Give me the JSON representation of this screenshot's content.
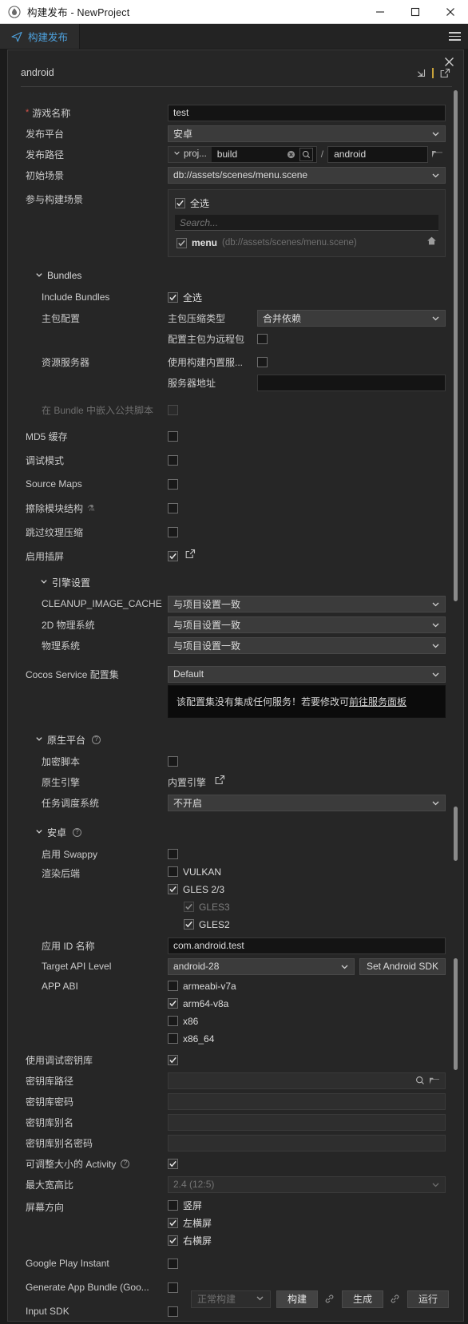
{
  "window": {
    "title": "构建发布 - NewProject",
    "minimize": "—",
    "maximize": "□",
    "close": "✕"
  },
  "tabstrip": {
    "tab_label": "构建发布",
    "menu_icon": "hamburger-icon"
  },
  "panel": {
    "title": "android",
    "close_label": "✕",
    "import_icon": "import-icon",
    "export_icon": "export-icon"
  },
  "fields": {
    "game_name": {
      "label": "游戏名称",
      "value": "test",
      "required": "*"
    },
    "platform": {
      "label": "发布平台",
      "value": "安卓"
    },
    "build_path": {
      "label": "发布路径",
      "root": "proj...",
      "dir": "build",
      "sub": "android",
      "separator": "/",
      "clear_icon": "clear-icon",
      "search_icon": "search-icon",
      "folder_icon": "folder-icon"
    },
    "start_scene": {
      "label": "初始场景",
      "value": "db://assets/scenes/menu.scene"
    },
    "include_scenes": {
      "label": "参与构建场景",
      "select_all": "全选",
      "search_placeholder": "Search...",
      "items": [
        {
          "name": "menu",
          "path": "(db://assets/scenes/menu.scene)",
          "checked": true,
          "home_icon": "home-icon"
        }
      ]
    },
    "bundles_group": "Bundles",
    "include_bundles": {
      "label": "Include Bundles",
      "select_all": "全选"
    },
    "main_bundle": {
      "label": "主包配置",
      "compress_label": "主包压缩类型",
      "compress_value": "合并依赖",
      "remote_label": "配置主包为远程包",
      "remote_checked": false
    },
    "asset_server": {
      "label": "资源服务器",
      "use_builtin_label": "使用构建内置服...",
      "use_builtin_checked": false,
      "address_label": "服务器地址",
      "address_value": ""
    },
    "embed_common_script": {
      "label": "在 Bundle 中嵌入公共脚本",
      "checked": false,
      "disabled": true
    },
    "md5_cache": {
      "label": "MD5 缓存",
      "checked": false
    },
    "debug_mode": {
      "label": "调试模式",
      "checked": false
    },
    "source_maps": {
      "label": "Source Maps",
      "checked": false
    },
    "erase_module_struct": {
      "label": "擦除模块结构",
      "checked": false,
      "badge": "experimental-flask-icon"
    },
    "skip_texture_compress": {
      "label": "跳过纹理压缩",
      "checked": false
    },
    "enable_splash": {
      "label": "启用插屏",
      "checked": true,
      "edit_icon": "edit-external-icon"
    },
    "engine_settings_group": "引擎设置",
    "cleanup_image_cache": {
      "label": "CLEANUP_IMAGE_CACHE",
      "value": "与项目设置一致"
    },
    "physics_2d": {
      "label": "2D 物理系统",
      "value": "与项目设置一致"
    },
    "physics": {
      "label": "物理系统",
      "value": "与项目设置一致"
    },
    "cocos_service": {
      "label": "Cocos Service 配置集",
      "value": "Default"
    },
    "service_tooltip": {
      "text": "该配置集没有集成任何服务！若要修改可",
      "link": "前往服务面板"
    },
    "native_group": {
      "label": "原生平台",
      "help": "?"
    },
    "encrypt_script": {
      "label": "加密脚本",
      "checked": false
    },
    "native_engine": {
      "label": "原生引擎",
      "value": "内置引擎",
      "edit_icon": "edit-external-icon"
    },
    "job_system": {
      "label": "任务调度系统",
      "value": "不开启"
    },
    "android_group": {
      "label": "安卓",
      "help": "?"
    },
    "enable_swappy": {
      "label": "启用 Swappy",
      "checked": false
    },
    "render_backend": {
      "label": "渲染后端",
      "options": [
        {
          "label": "VULKAN",
          "checked": false,
          "indent": 0,
          "disabled": false
        },
        {
          "label": "GLES 2/3",
          "checked": true,
          "indent": 0,
          "disabled": false
        },
        {
          "label": "GLES3",
          "checked": true,
          "indent": 1,
          "disabled": true
        },
        {
          "label": "GLES2",
          "checked": true,
          "indent": 1,
          "disabled": false
        }
      ]
    },
    "app_id": {
      "label": "应用 ID 名称",
      "value": "com.android.test"
    },
    "target_api": {
      "label": "Target API Level",
      "value": "android-28",
      "button": "Set Android SDK"
    },
    "app_abi": {
      "label": "APP ABI",
      "options": [
        {
          "label": "armeabi-v7a",
          "checked": false
        },
        {
          "label": "arm64-v8a",
          "checked": true
        },
        {
          "label": "x86",
          "checked": false
        },
        {
          "label": "x86_64",
          "checked": false
        }
      ]
    },
    "use_debug_keystore": {
      "label": "使用调试密钥库",
      "checked": true
    },
    "keystore_path": {
      "label": "密钥库路径",
      "value": "",
      "search_icon": "search-icon",
      "folder_icon": "folder-icon"
    },
    "keystore_password": {
      "label": "密钥库密码",
      "value": ""
    },
    "keystore_alias": {
      "label": "密钥库别名",
      "value": ""
    },
    "keystore_alias_password": {
      "label": "密钥库别名密码",
      "value": ""
    },
    "resizable_activity": {
      "label": "可调整大小的 Activity",
      "help": "?",
      "checked": true
    },
    "max_aspect_ratio": {
      "label": "最大宽高比",
      "value": "2.4 (12:5)"
    },
    "screen_orientation": {
      "label": "屏幕方向",
      "options": [
        {
          "label": "竖屏",
          "checked": false
        },
        {
          "label": "左横屏",
          "checked": true
        },
        {
          "label": "右横屏",
          "checked": true
        }
      ]
    },
    "google_play_instant": {
      "label": "Google Play Instant",
      "checked": false
    },
    "app_bundle": {
      "label": "Generate App Bundle (Goo...",
      "checked": false
    },
    "input_sdk": {
      "label": "Input SDK",
      "checked": false
    }
  },
  "footer": {
    "mode": "正常构建",
    "build": "构建",
    "generate": "生成",
    "run": "运行",
    "link_icon": "link-icon"
  },
  "colors": {
    "accent": "#4ea3e0",
    "required": "#d4534a",
    "divider": "#c8a23a",
    "panel_bg": "#262626"
  }
}
